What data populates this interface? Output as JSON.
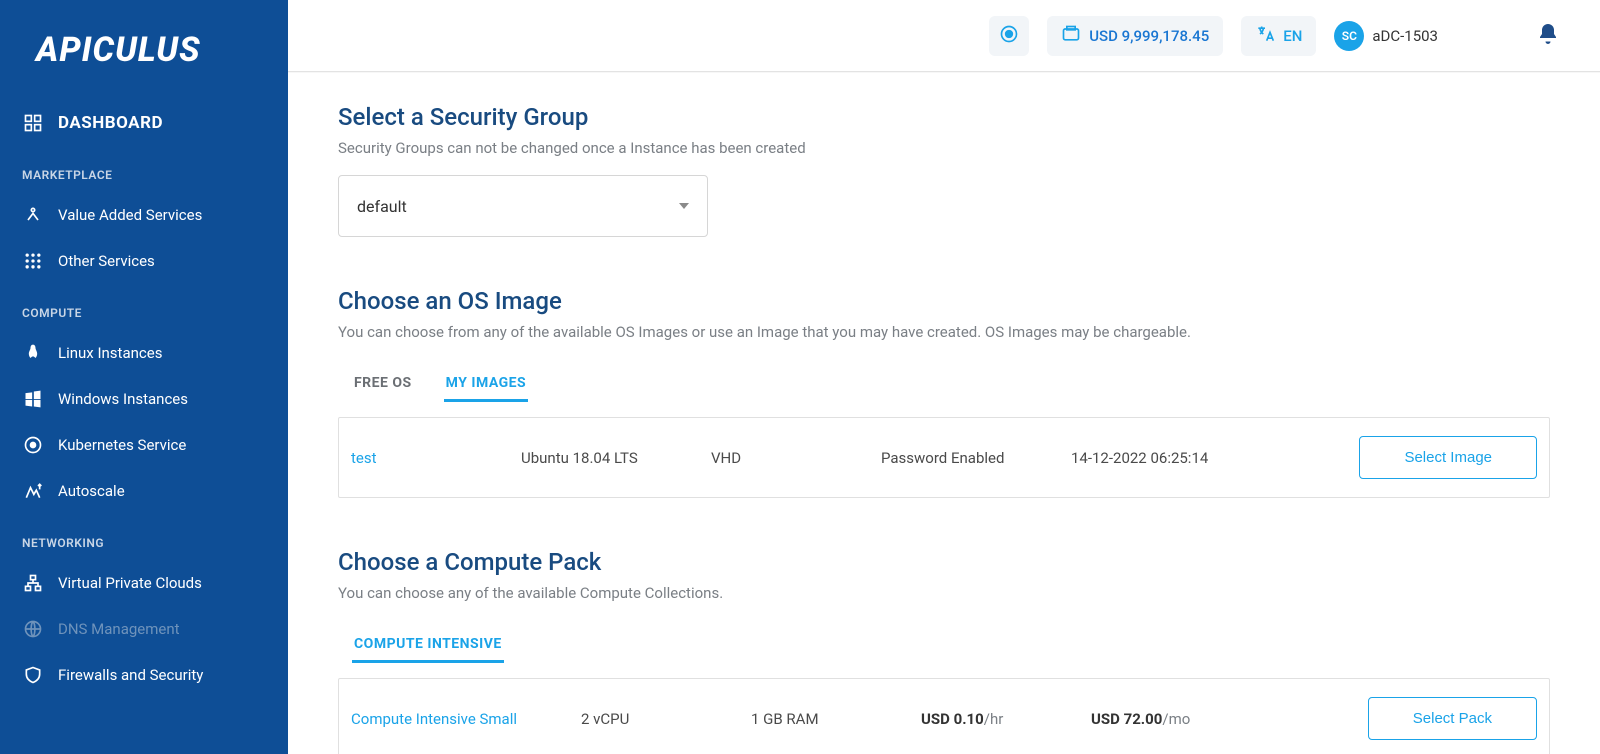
{
  "brand": "APICULUS",
  "sidebar": {
    "dashboard": "DASHBOARD",
    "sections": [
      {
        "label": "MARKETPLACE",
        "items": [
          {
            "label": "Value Added Services"
          },
          {
            "label": "Other Services"
          }
        ]
      },
      {
        "label": "COMPUTE",
        "items": [
          {
            "label": "Linux Instances"
          },
          {
            "label": "Windows Instances"
          },
          {
            "label": "Kubernetes Service"
          },
          {
            "label": "Autoscale"
          }
        ]
      },
      {
        "label": "NETWORKING",
        "items": [
          {
            "label": "Virtual Private Clouds"
          },
          {
            "label": "DNS Management",
            "disabled": true
          },
          {
            "label": "Firewalls and Security"
          }
        ]
      }
    ]
  },
  "topbar": {
    "balance": "USD 9,999,178.45",
    "lang": "EN",
    "avatar_initials": "SC",
    "username": "aDC-1503"
  },
  "security_group": {
    "title": "Select a Security Group",
    "subtitle": "Security Groups can not be changed once a Instance has been created",
    "selected": "default"
  },
  "os_image": {
    "title": "Choose an OS Image",
    "subtitle": "You can choose from any of the available OS Images or use an Image that you may have created. OS Images may be chargeable.",
    "tabs": [
      {
        "label": "FREE OS"
      },
      {
        "label": "MY IMAGES",
        "active": true
      }
    ],
    "rows": [
      {
        "name": "test",
        "os": "Ubuntu 18.04 LTS",
        "format": "VHD",
        "auth": "Password Enabled",
        "created": "14-12-2022 06:25:14",
        "action": "Select Image"
      }
    ]
  },
  "compute_pack": {
    "title": "Choose a Compute Pack",
    "subtitle": "You can choose any of the available Compute Collections.",
    "tabs": [
      {
        "label": "COMPUTE INTENSIVE",
        "active": true
      }
    ],
    "rows": [
      {
        "name": "Compute Intensive Small",
        "vcpu": "2 vCPU",
        "ram": "1 GB RAM",
        "price_hr_value": "USD 0.10",
        "price_hr_unit": "/hr",
        "price_mo_value": "USD 72.00",
        "price_mo_unit": "/mo",
        "action": "Select Pack"
      }
    ]
  }
}
